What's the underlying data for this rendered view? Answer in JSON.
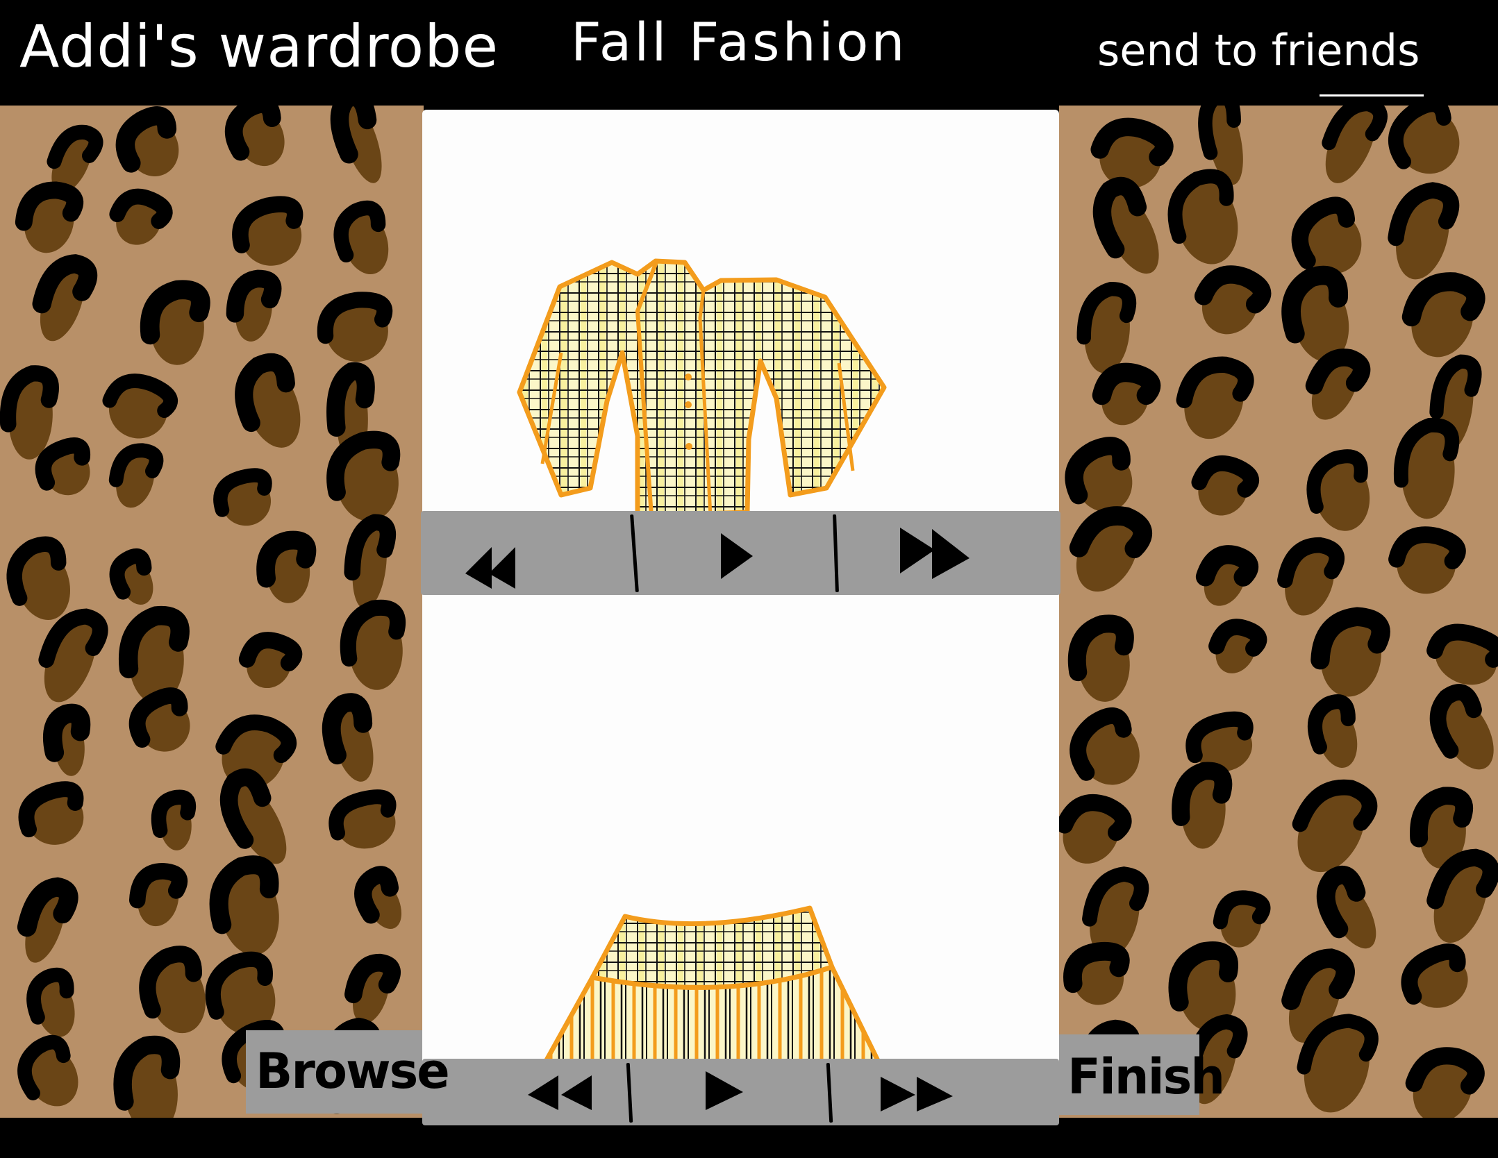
{
  "header": {
    "app_title": "Addi's wardrobe",
    "page_title": "Fall Fashion",
    "send_link": "send to friends"
  },
  "outfit": {
    "top_item_icon": "plaid-jacket-icon",
    "bottom_item_icon": "plaid-pleated-skirt-icon"
  },
  "controls": {
    "top": [
      "rewind-icon",
      "play-icon",
      "fast-forward-icon"
    ],
    "bottom": [
      "rewind-icon",
      "play-icon",
      "fast-forward-icon"
    ]
  },
  "buttons": {
    "browse_label": "Browse",
    "finish_label": "Finish"
  },
  "colors": {
    "background": "#000000",
    "leopard_base": "#b89068",
    "spot_brown": "#6a4516",
    "spot_black": "#000000",
    "panel": "#fdfdfd",
    "control_gray": "#9c9c9c",
    "plaid_orange": "#f39c1c",
    "plaid_yellow": "#f9f3a2"
  }
}
